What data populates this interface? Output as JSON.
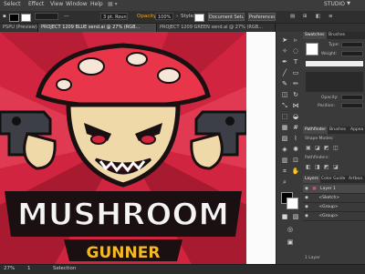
{
  "menu": {
    "items": [
      "Select",
      "Effect",
      "View",
      "Window",
      "Help"
    ],
    "workspace": "STUDIO"
  },
  "control_bar": {
    "stroke_weight": "3 pt. Round",
    "opacity_label": "Opacity:",
    "opacity_value": "100%",
    "style_label": "Style:",
    "document_setup": "Document Setup",
    "preferences": "Preferences"
  },
  "doc_tabs": [
    "PSPU (Preview)",
    "PROJECT 1209 BLUE send.ai @ 27% (RGB...",
    "PROJECT 1209 GREEN send.ai @ 27% (RGB..."
  ],
  "artwork": {
    "title_line1": "MUSHROOM",
    "title_line2": "GUNNER"
  },
  "panels": {
    "swatches_tabs": [
      "Swatches",
      "Brushes"
    ],
    "type_label": "Type:",
    "weight_label": "Weight:",
    "opacity_label": "Opacity:",
    "position_label": "Position:",
    "pathfinder_tabs": [
      "Pathfinder",
      "Brushes",
      "Appea"
    ],
    "shape_modes_label": "Shape Modes:",
    "pathfinders_label": "Pathfinders:",
    "layers_tabs": [
      "Layers",
      "Color Guide",
      "Artboa"
    ],
    "layers": [
      {
        "name": "Layer 1"
      },
      {
        "name": "<Sketch>"
      },
      {
        "name": "<Group>"
      },
      {
        "name": "<Group>"
      }
    ],
    "layers_count": "1 Layer"
  },
  "status": {
    "zoom": "27%",
    "page": "1",
    "tool": "Selection"
  },
  "colors": {
    "artboard_bg": "#d02440",
    "accent": "#f5a623",
    "ui_dark": "#323232"
  }
}
